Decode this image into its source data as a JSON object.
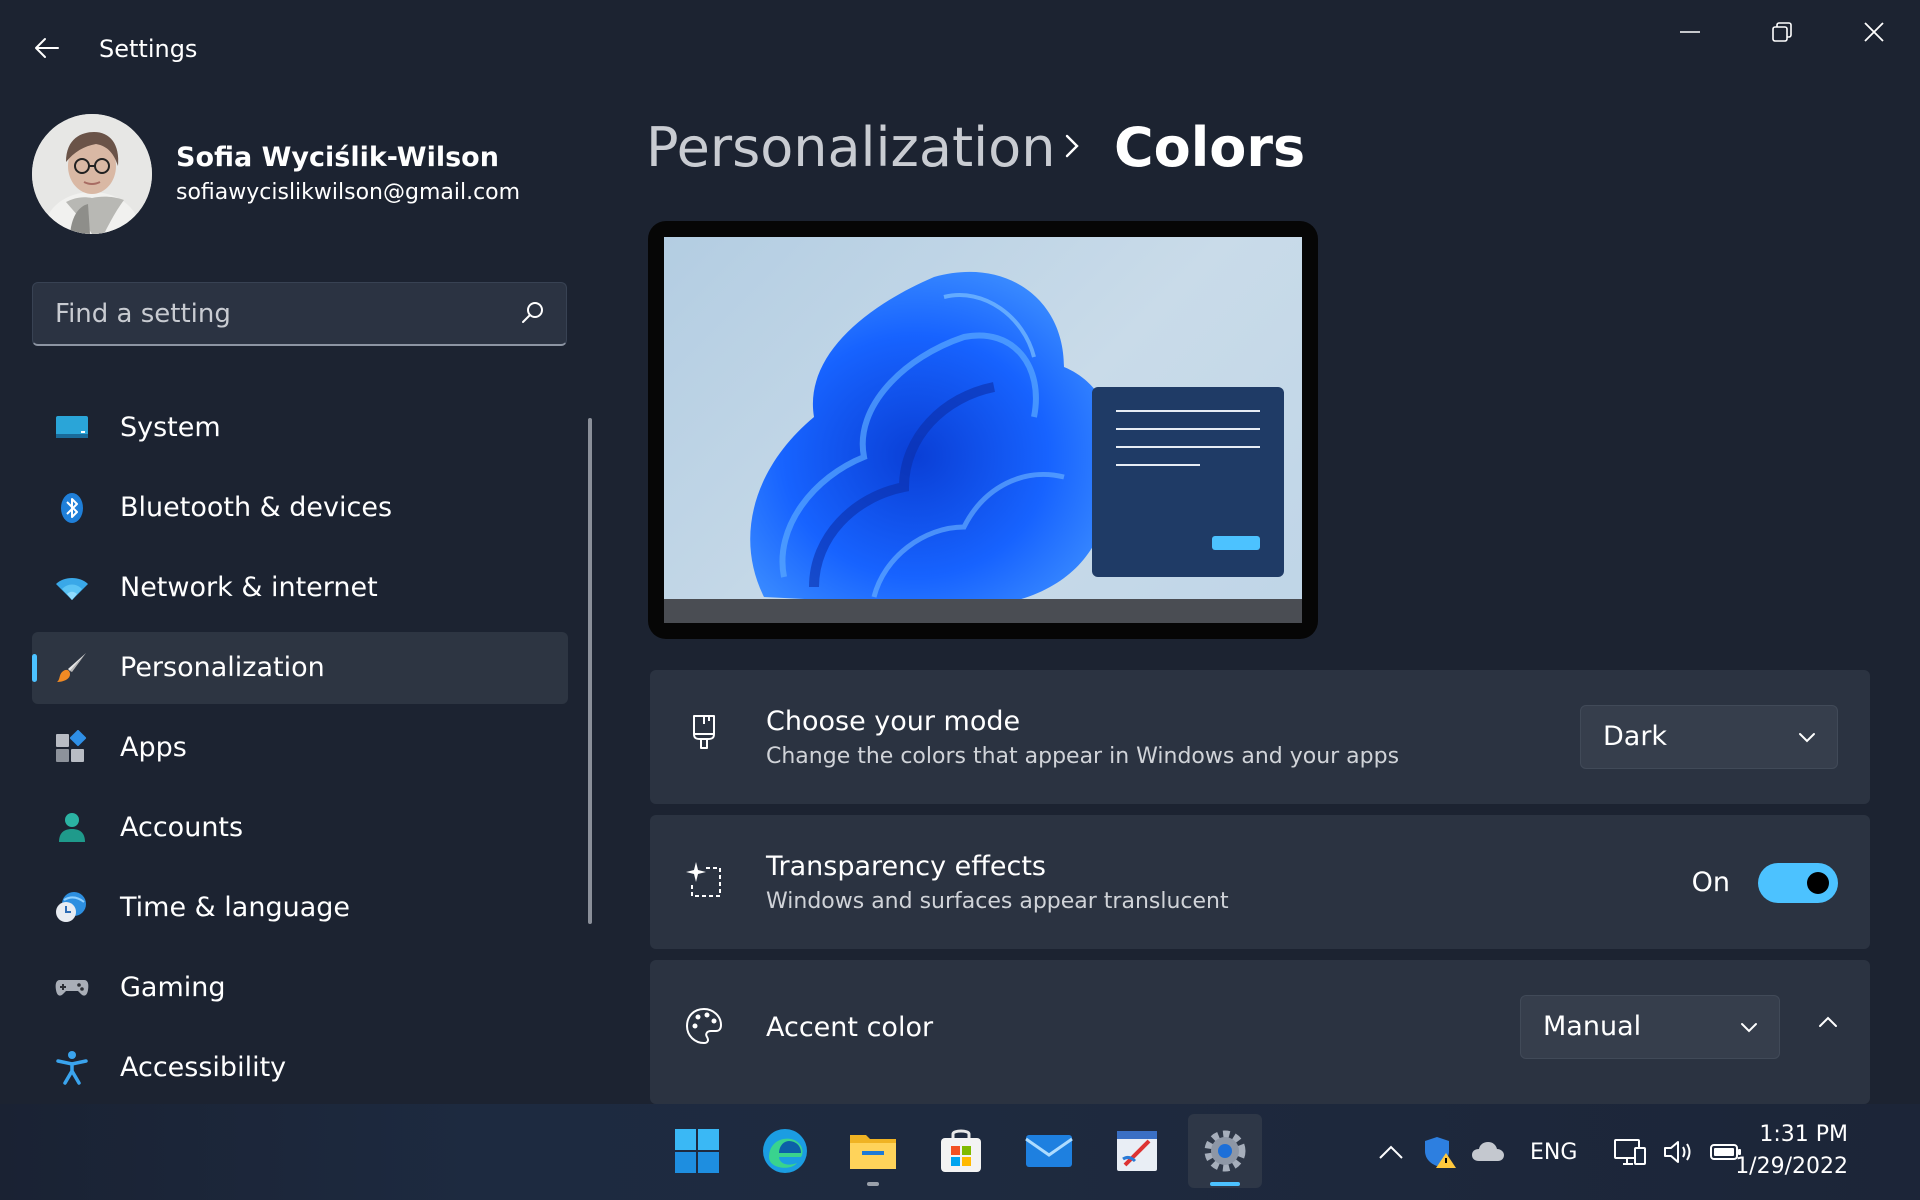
{
  "window": {
    "title": "Settings",
    "controls": [
      "minimize-icon",
      "restore-icon",
      "close-icon"
    ]
  },
  "profile": {
    "name": "Sofia Wyciślik-Wilson",
    "email": "sofiawycislikwilson@gmail.com"
  },
  "search": {
    "placeholder": "Find a setting",
    "value": ""
  },
  "sidebar": {
    "items": [
      {
        "label": "System",
        "icon": "system-display-icon"
      },
      {
        "label": "Bluetooth & devices",
        "icon": "bluetooth-icon"
      },
      {
        "label": "Network & internet",
        "icon": "wifi-icon"
      },
      {
        "label": "Personalization",
        "icon": "paintbrush-icon",
        "selected": true
      },
      {
        "label": "Apps",
        "icon": "apps-icon"
      },
      {
        "label": "Accounts",
        "icon": "person-icon"
      },
      {
        "label": "Time & language",
        "icon": "globe-clock-icon"
      },
      {
        "label": "Gaming",
        "icon": "gamepad-icon"
      },
      {
        "label": "Accessibility",
        "icon": "accessibility-icon"
      }
    ]
  },
  "breadcrumb": {
    "parent": "Personalization",
    "current": "Colors"
  },
  "cards": {
    "mode": {
      "title": "Choose your mode",
      "subtitle": "Change the colors that appear in Windows and your apps",
      "value": "Dark"
    },
    "transparency": {
      "title": "Transparency effects",
      "subtitle": "Windows and surfaces appear translucent",
      "state": "On"
    },
    "accent": {
      "title": "Accent color",
      "value": "Manual"
    }
  },
  "taskbar": {
    "apps": [
      "start-icon",
      "edge-icon",
      "file-explorer-icon",
      "store-icon",
      "mail-icon",
      "paint-icon",
      "settings-icon"
    ],
    "language": "ENG",
    "time": "1:31 PM",
    "date": "1/29/2022"
  },
  "colors": {
    "background": "#1c2331",
    "card": "#2b3341",
    "accent": "#4cc2ff"
  }
}
